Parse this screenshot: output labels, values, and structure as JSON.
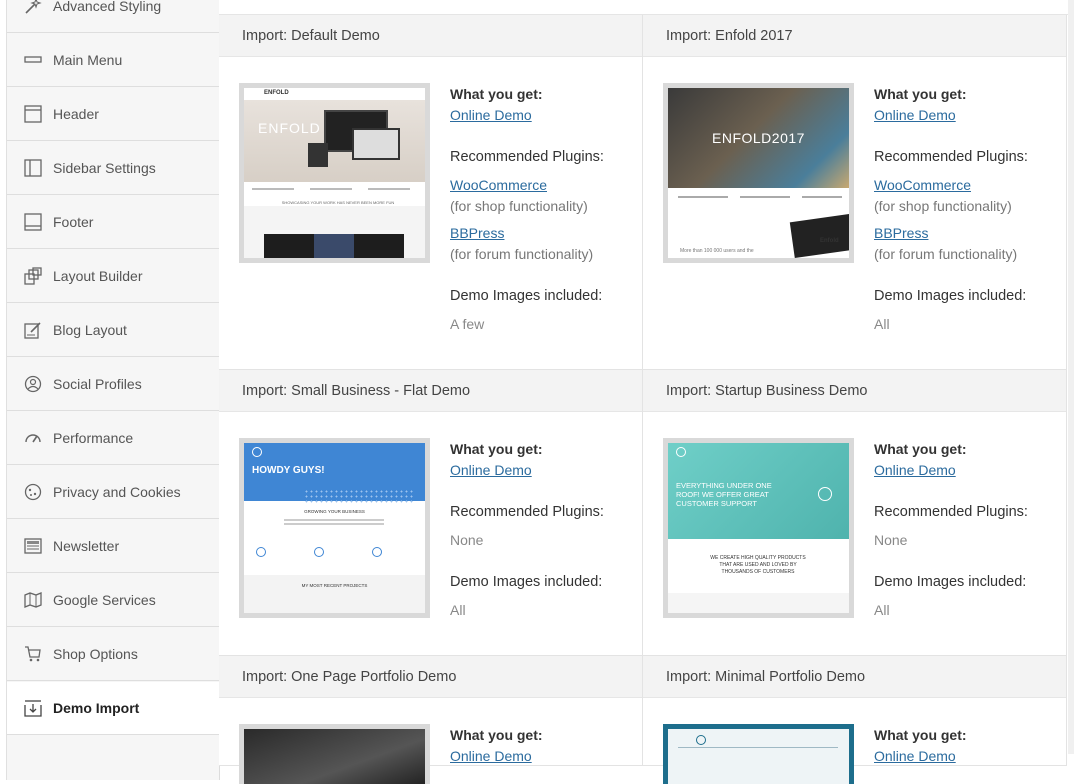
{
  "sidebar": {
    "items": [
      {
        "label": "Advanced Styling",
        "icon": "magic-wand-icon"
      },
      {
        "label": "Main Menu",
        "icon": "menu-bar-icon"
      },
      {
        "label": "Header",
        "icon": "header-layout-icon"
      },
      {
        "label": "Sidebar Settings",
        "icon": "sidebar-layout-icon"
      },
      {
        "label": "Footer",
        "icon": "footer-layout-icon"
      },
      {
        "label": "Layout Builder",
        "icon": "layout-builder-icon"
      },
      {
        "label": "Blog Layout",
        "icon": "edit-page-icon"
      },
      {
        "label": "Social Profiles",
        "icon": "user-circle-icon"
      },
      {
        "label": "Performance",
        "icon": "speedometer-icon"
      },
      {
        "label": "Privacy and Cookies",
        "icon": "cookie-icon"
      },
      {
        "label": "Newsletter",
        "icon": "newspaper-icon"
      },
      {
        "label": "Google Services",
        "icon": "map-icon"
      },
      {
        "label": "Shop Options",
        "icon": "cart-icon"
      },
      {
        "label": "Demo Import",
        "icon": "import-icon",
        "active": true
      }
    ]
  },
  "demos": [
    {
      "title": "Import: Default Demo",
      "what_label": "What you get:",
      "online_label": "Online Demo",
      "plugins_label": "Recommended Plugins:",
      "plugins": [
        {
          "name": "WooCommerce",
          "desc": "(for shop functionality)"
        },
        {
          "name": "BBPress",
          "desc": "(for forum functionality)"
        }
      ],
      "images_label": "Demo Images included:",
      "images_value": "A few"
    },
    {
      "title": "Import: Enfold 2017",
      "what_label": "What you get:",
      "online_label": "Online Demo",
      "plugins_label": "Recommended Plugins:",
      "plugins": [
        {
          "name": "WooCommerce",
          "desc": "(for shop functionality)"
        },
        {
          "name": "BBPress",
          "desc": "(for forum functionality)"
        }
      ],
      "images_label": "Demo Images included:",
      "images_value": "All"
    },
    {
      "title": "Import: Small Business - Flat Demo",
      "what_label": "What you get:",
      "online_label": "Online Demo",
      "plugins_label": "Recommended Plugins:",
      "plugins_none": "None",
      "images_label": "Demo Images included:",
      "images_value": "All"
    },
    {
      "title": "Import: Startup Business Demo",
      "what_label": "What you get:",
      "online_label": "Online Demo",
      "plugins_label": "Recommended Plugins:",
      "plugins_none": "None",
      "images_label": "Demo Images included:",
      "images_value": "All"
    },
    {
      "title": "Import: One Page Portfolio Demo",
      "what_label": "What you get:",
      "online_label": "Online Demo"
    },
    {
      "title": "Import: Minimal Portfolio Demo",
      "what_label": "What you get:",
      "online_label": "Online Demo"
    }
  ],
  "thumbs": {
    "default": {
      "logo": "ENFOLD",
      "hero": "ENFOLD",
      "tagline": "SHOWCASING YOUR WORK HAS NEVER BEEN MORE FUN"
    },
    "enfold2017": {
      "hero": "ENFOLD2017",
      "footer_text": "More than 100 000 users and the",
      "brand": "Enfold"
    },
    "small_business": {
      "hero": "HOWDY GUYS!",
      "section": "GROWING YOUR BUSINESS",
      "projects": "MY MOST RECENT PROJECTS"
    },
    "startup": {
      "hero": "EVERYTHING UNDER ONE ROOF! WE OFFER GREAT CUSTOMER SUPPORT",
      "claim": "WE CREATE HIGH QUALITY PRODUCTS THAT ARE USED AND LOVED BY THOUSANDS OF CUSTOMERS"
    }
  },
  "colors": {
    "link": "#2b6b9e",
    "small_business_blue": "#3f86d4",
    "startup_teal": "#5cc3bd",
    "minimal_teal": "#1d6e8c"
  }
}
